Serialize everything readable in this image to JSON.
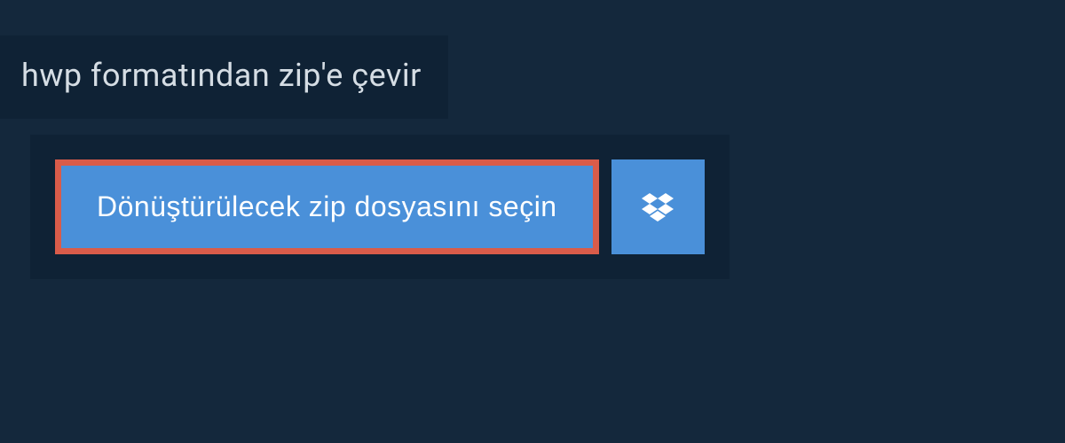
{
  "header": {
    "title": "hwp formatından zip'e çevir"
  },
  "actions": {
    "select_file_label": "Dönüştürülecek zip dosyasını seçin"
  },
  "colors": {
    "page_bg": "#14283c",
    "panel_bg": "#0f2235",
    "button_bg": "#4a90d9",
    "highlight_border": "#d95c4a",
    "text_light": "#d5dde4",
    "text_white": "#ffffff"
  }
}
